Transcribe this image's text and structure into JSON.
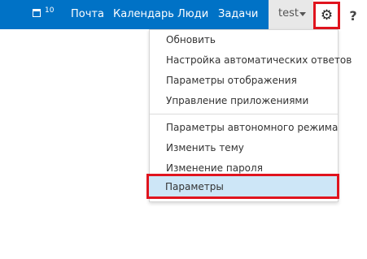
{
  "header": {
    "calendar_icon": "calendar-icon",
    "calendar_count": "10",
    "nav": [
      "Почта",
      "Календарь",
      "Люди",
      "Задачи"
    ],
    "user": "test",
    "settings_icon": "gear-icon",
    "help_label": "?",
    "colors": {
      "bar": "#0072c6",
      "highlight_border": "#e0141e",
      "selected_bg": "#cde6f7"
    }
  },
  "menu": {
    "items": [
      "Обновить",
      "Настройка автоматических ответов",
      "Параметры отображения",
      "Управление приложениями",
      "Параметры автономного режима",
      "Изменить тему",
      "Изменение пароля",
      "Параметры"
    ],
    "selected": "Параметры"
  }
}
